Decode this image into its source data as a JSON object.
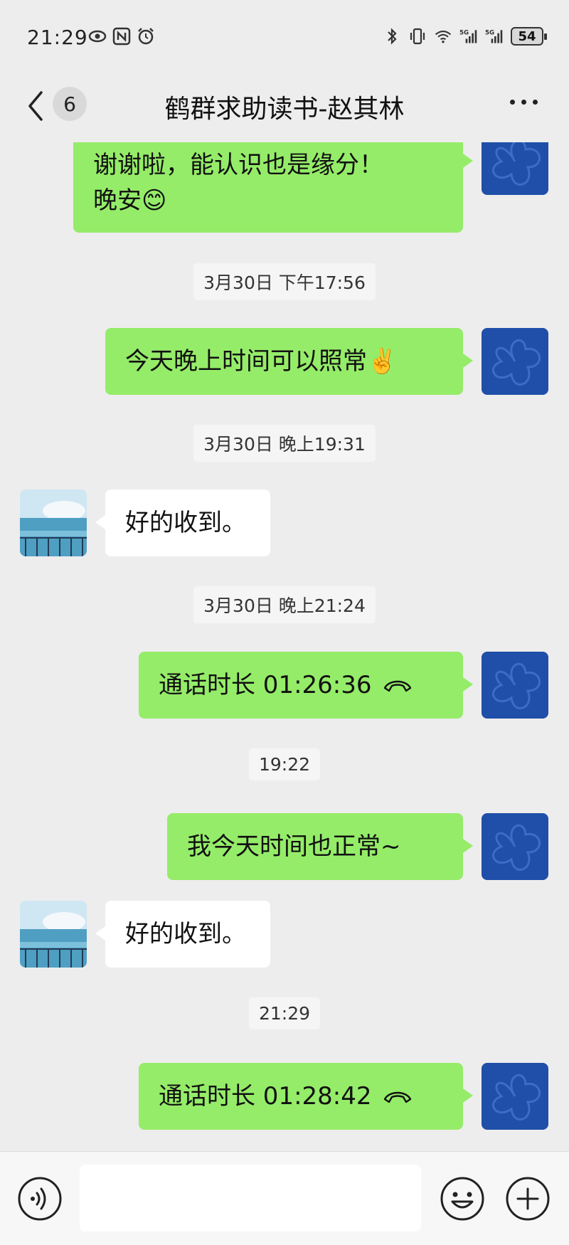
{
  "status_bar": {
    "time": "21:29",
    "battery": "54",
    "left_icons": [
      "eye-icon",
      "nfc-icon",
      "alarm-icon"
    ],
    "right_icons": [
      "bluetooth-icon",
      "vibrate-icon",
      "wifi-icon",
      "signal-5g-icon",
      "signal-5g-icon",
      "battery-icon"
    ]
  },
  "header": {
    "unread_count": "6",
    "title": "鹤群求助读书-赵其林"
  },
  "messages": [
    {
      "id": "m1",
      "side": "out",
      "lines": [
        "谢谢啦，能认识也是缘分！",
        "晚安😊"
      ]
    },
    {
      "id": "t1",
      "type": "time",
      "text": "3月30日 下午17:56"
    },
    {
      "id": "m2",
      "side": "out",
      "text": "今天晚上时间可以照常✌️"
    },
    {
      "id": "t2",
      "type": "time",
      "text": "3月30日 晚上19:31"
    },
    {
      "id": "m3",
      "side": "in",
      "text": "好的收到。"
    },
    {
      "id": "t3",
      "type": "time",
      "text": "3月30日 晚上21:24"
    },
    {
      "id": "m4",
      "side": "out",
      "text": "通话时长 01:26:36",
      "call": true
    },
    {
      "id": "t4",
      "type": "time",
      "text": "19:22"
    },
    {
      "id": "m5",
      "side": "out",
      "text": "我今天时间也正常~"
    },
    {
      "id": "m6",
      "side": "in",
      "text": "好的收到。"
    },
    {
      "id": "t5",
      "type": "time",
      "text": "21:29"
    },
    {
      "id": "m7",
      "side": "out",
      "text": "通话时长 01:28:42",
      "call": true
    }
  ],
  "input_bar": {
    "icons": [
      "voice-icon",
      "emoji-icon",
      "plus-icon"
    ]
  },
  "colors": {
    "background": "#ededed",
    "bubble_out": "#95ec69",
    "bubble_in": "#ffffff",
    "avatar_self": "#1f4fa8"
  }
}
